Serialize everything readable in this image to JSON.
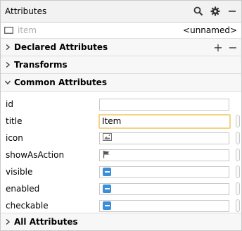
{
  "panel": {
    "title": "Attributes",
    "icons": [
      "search-icon",
      "gear-icon",
      "minimize-icon"
    ]
  },
  "item": {
    "icon": "menu-item-icon",
    "placeholder": "item",
    "value": "<unnamed>"
  },
  "sections": {
    "declared": "Declared Attributes",
    "transforms": "Transforms",
    "common": "Common Attributes",
    "all": "All Attributes",
    "declared_add": "+",
    "declared_remove": "−"
  },
  "attributes": {
    "id": {
      "label": "id",
      "value": ""
    },
    "title": {
      "label": "title",
      "value": "Item"
    },
    "icon": {
      "label": "icon",
      "value": "",
      "icon": "image-icon"
    },
    "showAsAction": {
      "label": "showAsAction",
      "value": "",
      "icon": "flag-icon"
    },
    "visible": {
      "label": "visible",
      "state": "indeterminate"
    },
    "enabled": {
      "label": "enabled",
      "state": "indeterminate"
    },
    "checkable": {
      "label": "checkable",
      "state": "indeterminate"
    }
  },
  "colors": {
    "focus": "#f3d486",
    "tristate": "#3b8fd9"
  }
}
